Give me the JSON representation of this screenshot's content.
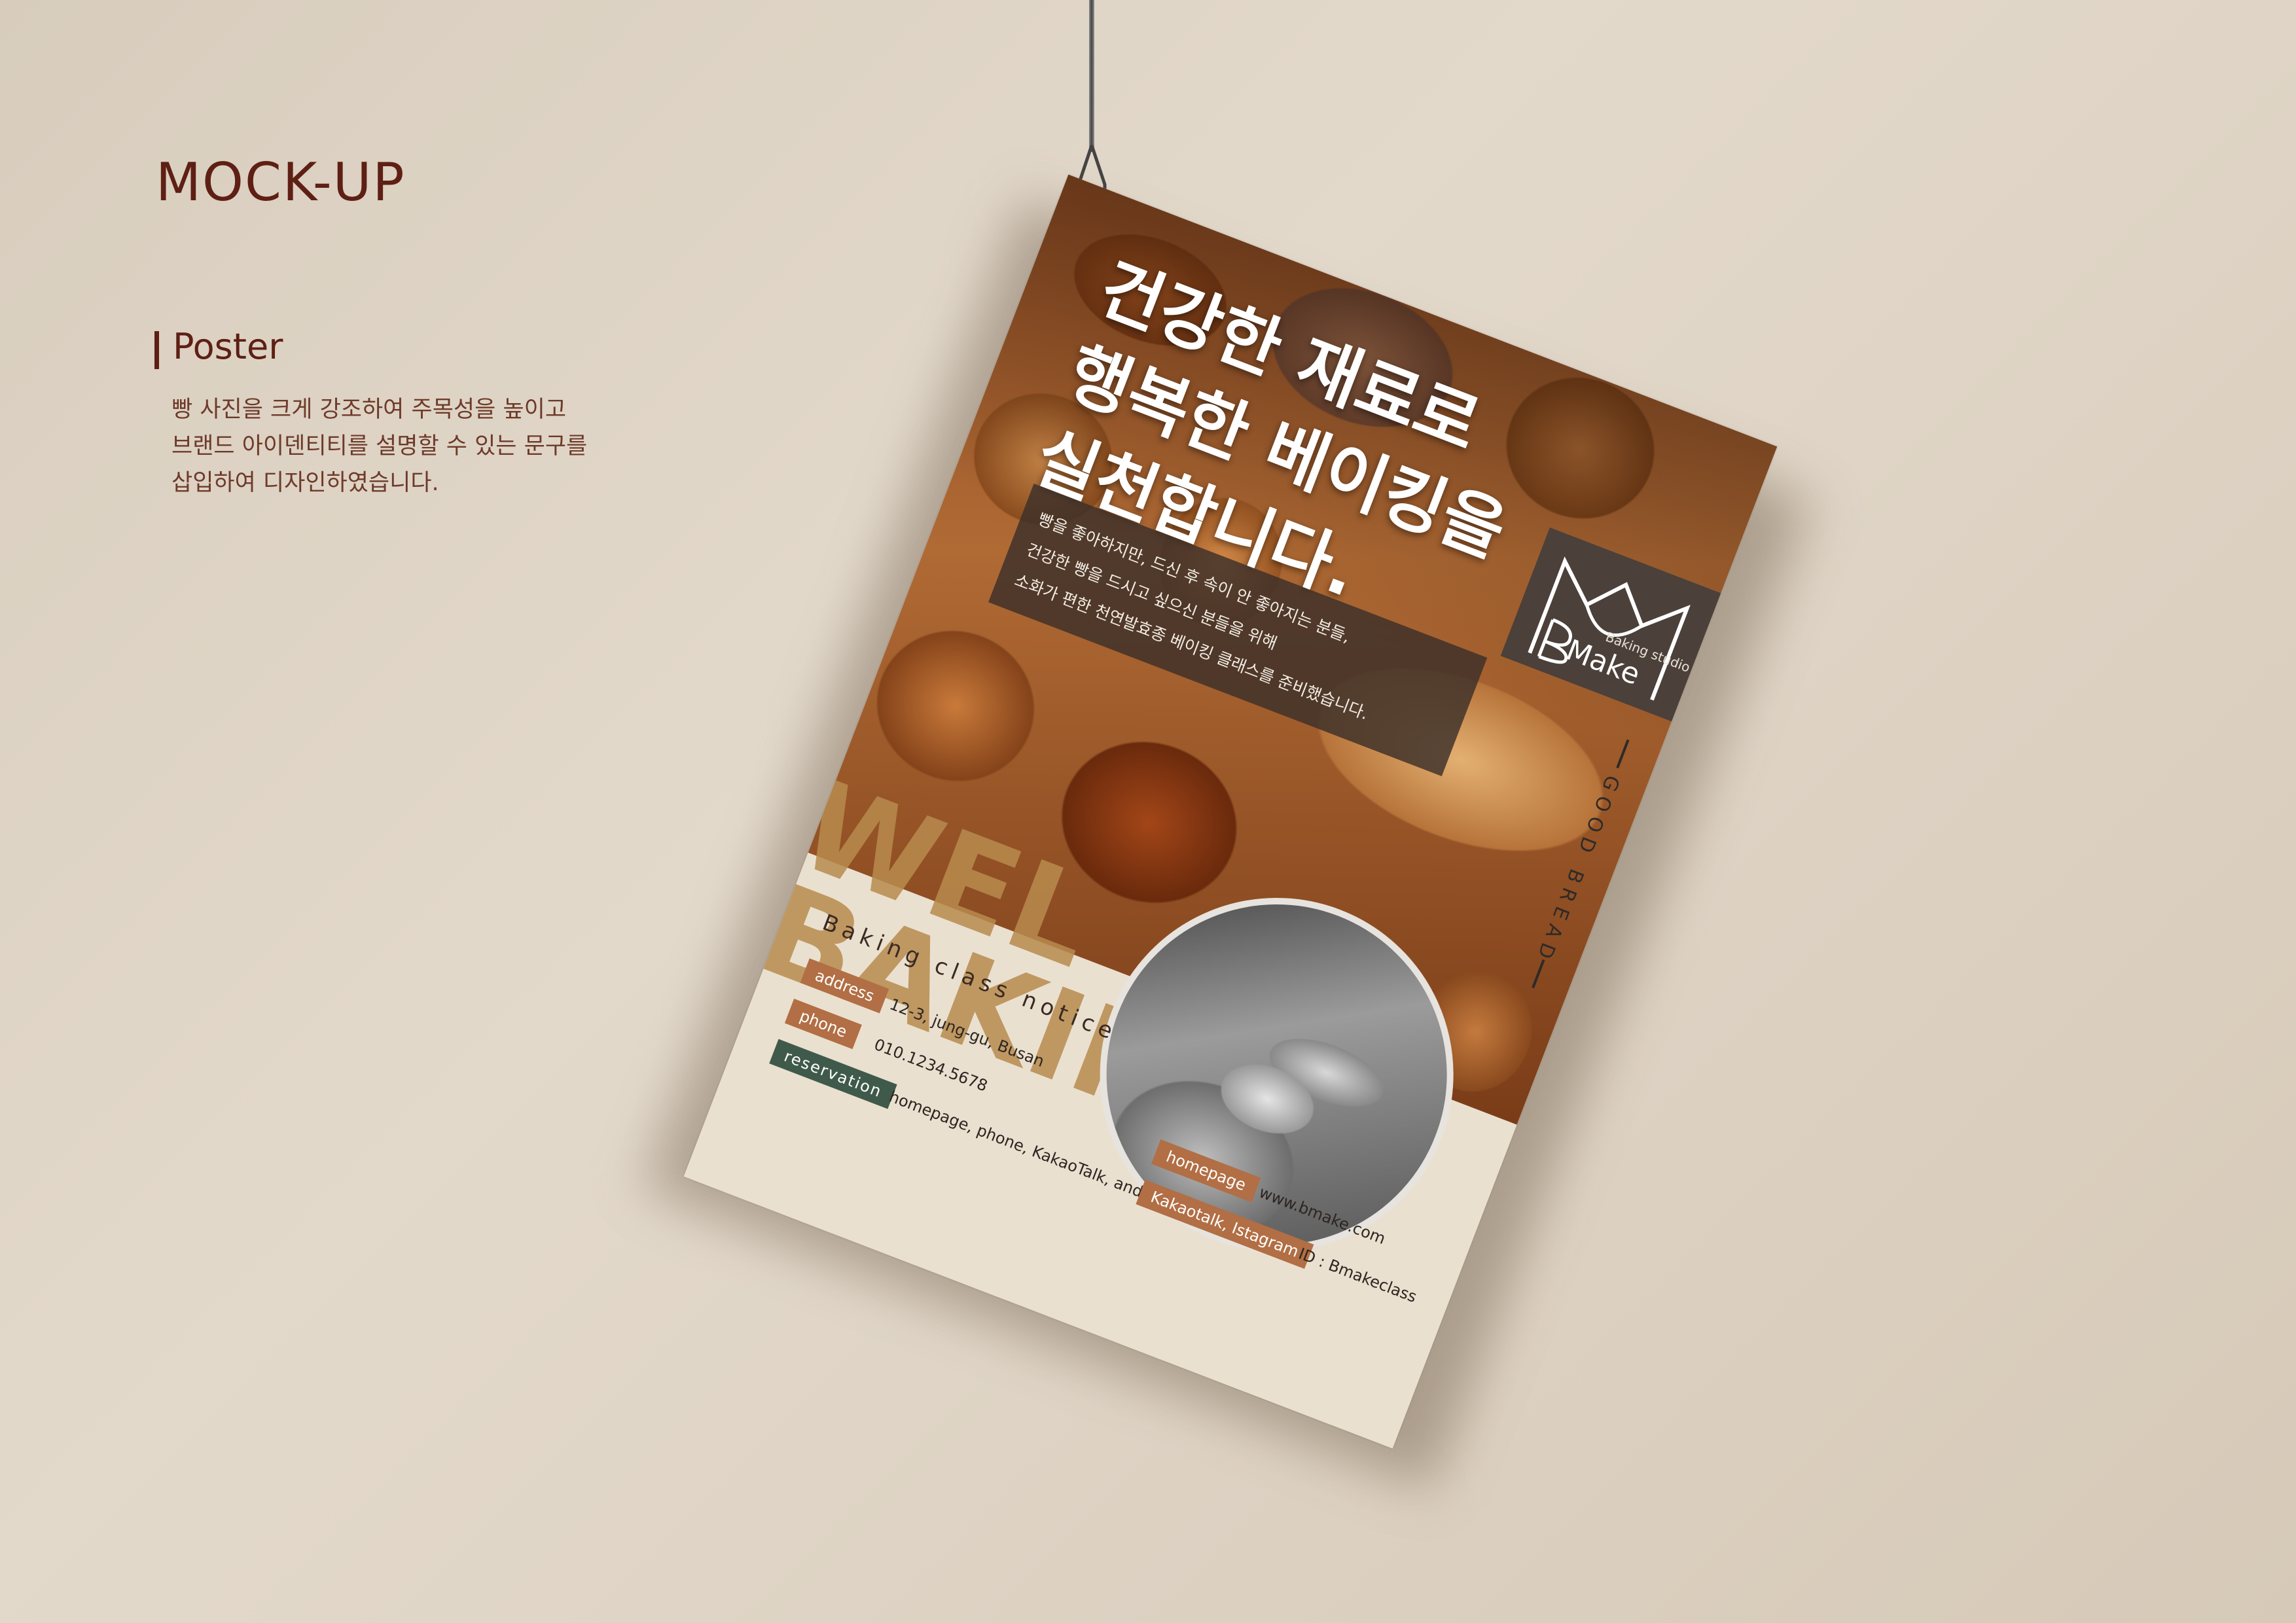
{
  "page": {
    "title": "MOCK-UP",
    "section_title": "Poster",
    "description": [
      "빵 사진을 크게 강조하여 주목성을 높이고",
      "브랜드 아이덴티티를 설명할 수 있는 문구를",
      "삽입하여 디자인하였습니다."
    ]
  },
  "poster": {
    "headline": [
      "건강한 재료로",
      "행복한 베이킹을",
      "실천합니다."
    ],
    "subtext": [
      "빵을 좋아하지만, 드신 후 속이 안 좋아지는 분들,",
      "건강한 빵을 드시고 싶으신 분들을 위해",
      "소화가 편한 천연발효종 베이킹 클래스를 준비했습니다."
    ],
    "logo": {
      "studio": "Baking studio",
      "name": "Make",
      "initial": "B"
    },
    "side_text": "GOOD BREAD",
    "big_text": [
      "WEL",
      "BAKIN"
    ],
    "notice_title": "Baking class notice",
    "info": {
      "address_label": "address",
      "address_value": "12-3, jung-gu, Busan",
      "phone_label": "phone",
      "phone_value": "010.1234.5678",
      "reservation_label": "reservation",
      "reservation_value": "homepage, phone, KakaoTalk, and Instagram dm.",
      "homepage_label": "homepage",
      "homepage_value": "www.bmake.com",
      "kakao_label": "Kakaotalk, Istagram",
      "kakao_value": "ID : Bmakeclass"
    }
  },
  "colors": {
    "background": "#ddd2c3",
    "title": "#5e1f14",
    "tag_orange": "#b26e44",
    "tag_green": "#3f5a4a",
    "logo_bg": "#4b403a"
  }
}
